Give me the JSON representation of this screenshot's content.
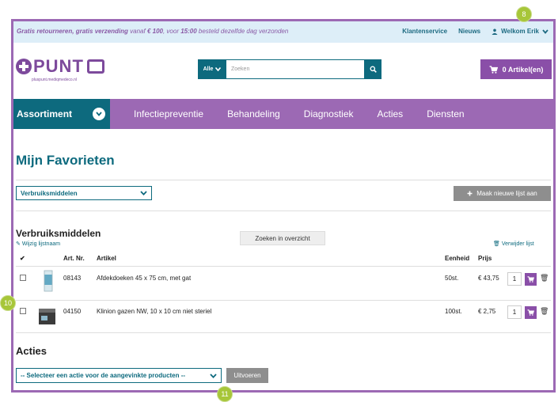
{
  "topbar": {
    "promo_bold": "Gratis retourneren, gratis verzending",
    "promo_mid": " vanaf ",
    "promo_amount": "€ 100",
    "promo_sep": ", voor ",
    "promo_time": "15:00",
    "promo_end": " besteld dezelfde dag verzonden",
    "link_service": "Klantenservice",
    "link_news": "Nieuws",
    "welcome": "Welkom Erik"
  },
  "logo": {
    "text": "PUNT",
    "sub": "pluspunt.mediqmedeco.nl"
  },
  "search": {
    "scope": "Alle",
    "placeholder": "Zoeken"
  },
  "cart": {
    "label": "0 Artikel(en)"
  },
  "nav": {
    "assortiment": "Assortiment",
    "items": [
      "Infectiepreventie",
      "Behandeling",
      "Diagnostiek",
      "Acties",
      "Diensten"
    ]
  },
  "page": {
    "title": "Mijn Favorieten"
  },
  "list_select": {
    "value": "Verbruiksmiddelen"
  },
  "new_list_button": "Maak nieuwe lijst aan",
  "list": {
    "name": "Verbruiksmiddelen",
    "edit_label": "Wijzig lijstnaam",
    "search_button": "Zoeken in overzicht",
    "remove_label": "Verwijder lijst"
  },
  "table": {
    "headers": {
      "check": "✔",
      "artnr": "Art. Nr.",
      "article": "Artikel",
      "unit": "Eenheid",
      "price": "Prijs"
    },
    "rows": [
      {
        "artnr": "08143",
        "article": "Afdekdoeken 45 x 75 cm, met gat",
        "unit": "50st.",
        "price": "€ 43,75",
        "qty": "1"
      },
      {
        "artnr": "04150",
        "article": "Klinion gazen NW, 10 x 10 cm niet steriel",
        "unit": "100st.",
        "price": "€ 2,75",
        "qty": "1"
      }
    ]
  },
  "actions": {
    "title": "Acties",
    "select_value": "-- Selecteer een actie voor de aangevinkte producten --",
    "run_button": "Uitvoeren"
  },
  "markers": {
    "m8": "8",
    "m10": "10",
    "m11": "11"
  },
  "colors": {
    "purple": "#9c69b4",
    "teal": "#0d6a7e",
    "grey_button": "#8e8e8e",
    "marker": "#a7c639"
  }
}
